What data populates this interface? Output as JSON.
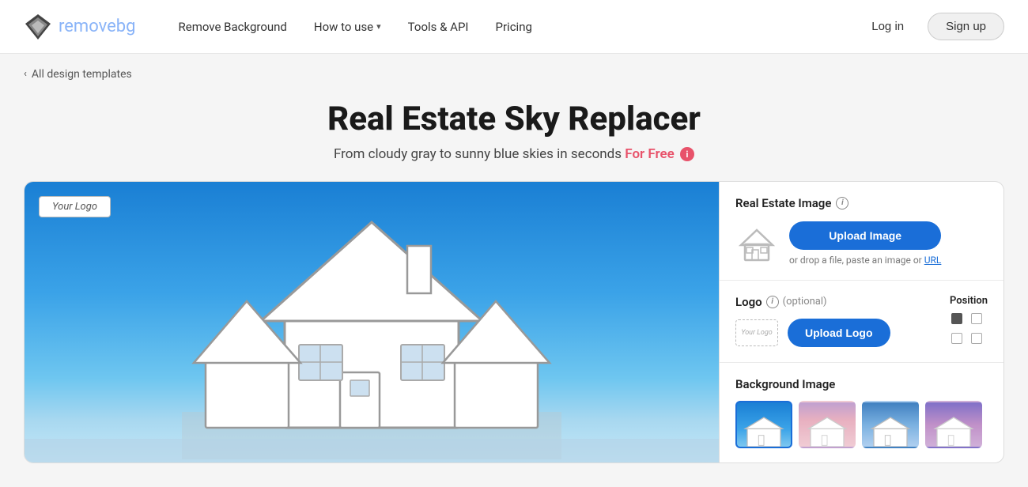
{
  "header": {
    "logo_text": "remove",
    "logo_text_bg": "bg",
    "nav_items": [
      {
        "id": "remove-background",
        "label": "Remove Background"
      },
      {
        "id": "how-to-use",
        "label": "How to use",
        "has_dropdown": true
      },
      {
        "id": "tools-api",
        "label": "Tools & API"
      },
      {
        "id": "pricing",
        "label": "Pricing"
      }
    ],
    "login_label": "Log in",
    "signup_label": "Sign up"
  },
  "breadcrumb": {
    "label": "All design templates"
  },
  "page": {
    "title": "Real Estate Sky Replacer",
    "subtitle": "From cloudy gray to sunny blue skies in seconds",
    "for_free_label": "For Free",
    "info_symbol": "i"
  },
  "right_panel": {
    "real_estate_section": {
      "title": "Real Estate Image",
      "upload_button": "Upload Image",
      "drop_hint": "or drop a file, paste an image or",
      "url_label": "URL"
    },
    "logo_section": {
      "title": "Logo",
      "optional_label": "(optional)",
      "upload_button": "Upload Logo",
      "position_label": "Position",
      "logo_placeholder": "Your Logo"
    },
    "background_section": {
      "title": "Background Image"
    }
  },
  "canvas": {
    "watermark": "Your Logo"
  },
  "icons": {
    "chevron_left": "‹",
    "chevron_down": "∨",
    "info": "i"
  }
}
